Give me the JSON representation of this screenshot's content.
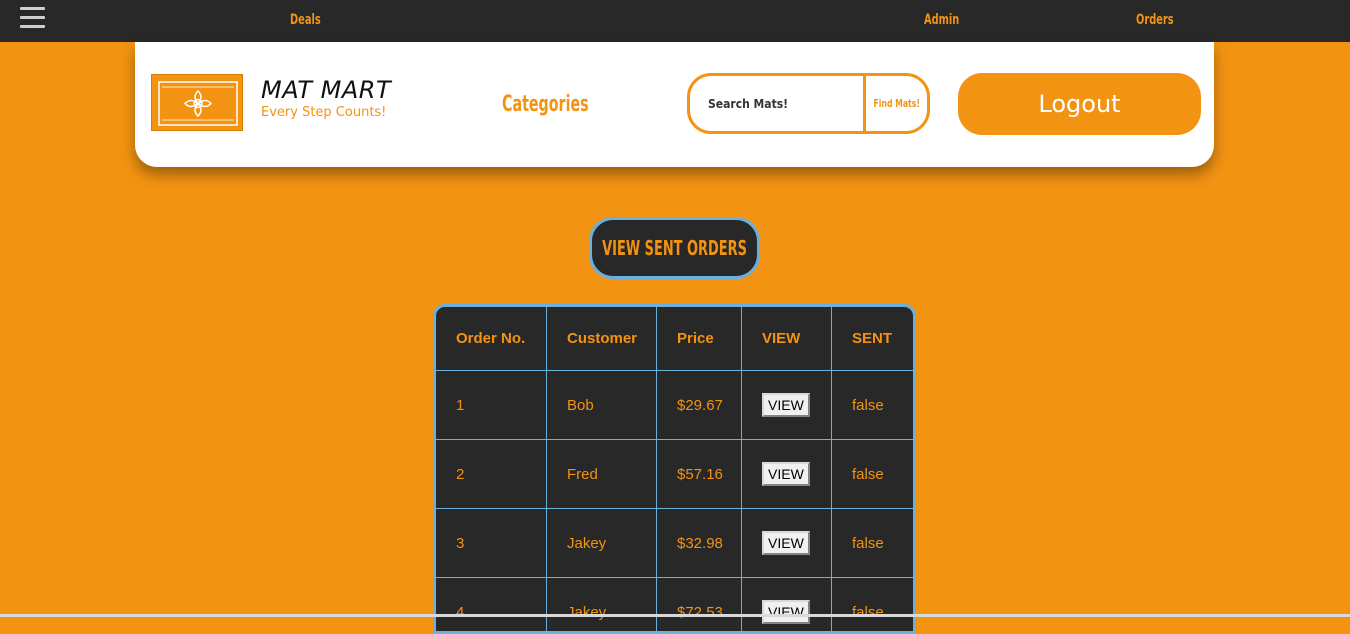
{
  "topbar": {
    "menu_icon": "hamburger-menu-icon",
    "links": [
      "Deals",
      "Admin",
      "Orders"
    ]
  },
  "header": {
    "logo_icon": "ornament-logo-icon",
    "brand_title": "MAT MART",
    "brand_tagline": "Every Step Counts!",
    "categories_label": "Categories",
    "search": {
      "placeholder": "Search Mats!",
      "button_label": "Find Mats!"
    },
    "logout_label": "Logout"
  },
  "main": {
    "view_sent_orders_label": "VIEW SENT ORDERS",
    "orders_table": {
      "headers": [
        "Order No.",
        "Customer",
        "Price",
        "VIEW",
        "SENT"
      ],
      "rows": [
        {
          "order_no": "1",
          "customer": "Bob",
          "price": "$29.67",
          "view_label": "VIEW",
          "sent": "false"
        },
        {
          "order_no": "2",
          "customer": "Fred",
          "price": "$57.16",
          "view_label": "VIEW",
          "sent": "false"
        },
        {
          "order_no": "3",
          "customer": "Jakey",
          "price": "$32.98",
          "view_label": "VIEW",
          "sent": "false"
        },
        {
          "order_no": "4",
          "customer": "Jakey",
          "price": "$72.53",
          "view_label": "VIEW",
          "sent": "false"
        }
      ]
    }
  },
  "colors": {
    "accent": "#f39312",
    "dark": "#282828",
    "table_border": "#6ab0de",
    "card": "#ffffff"
  }
}
